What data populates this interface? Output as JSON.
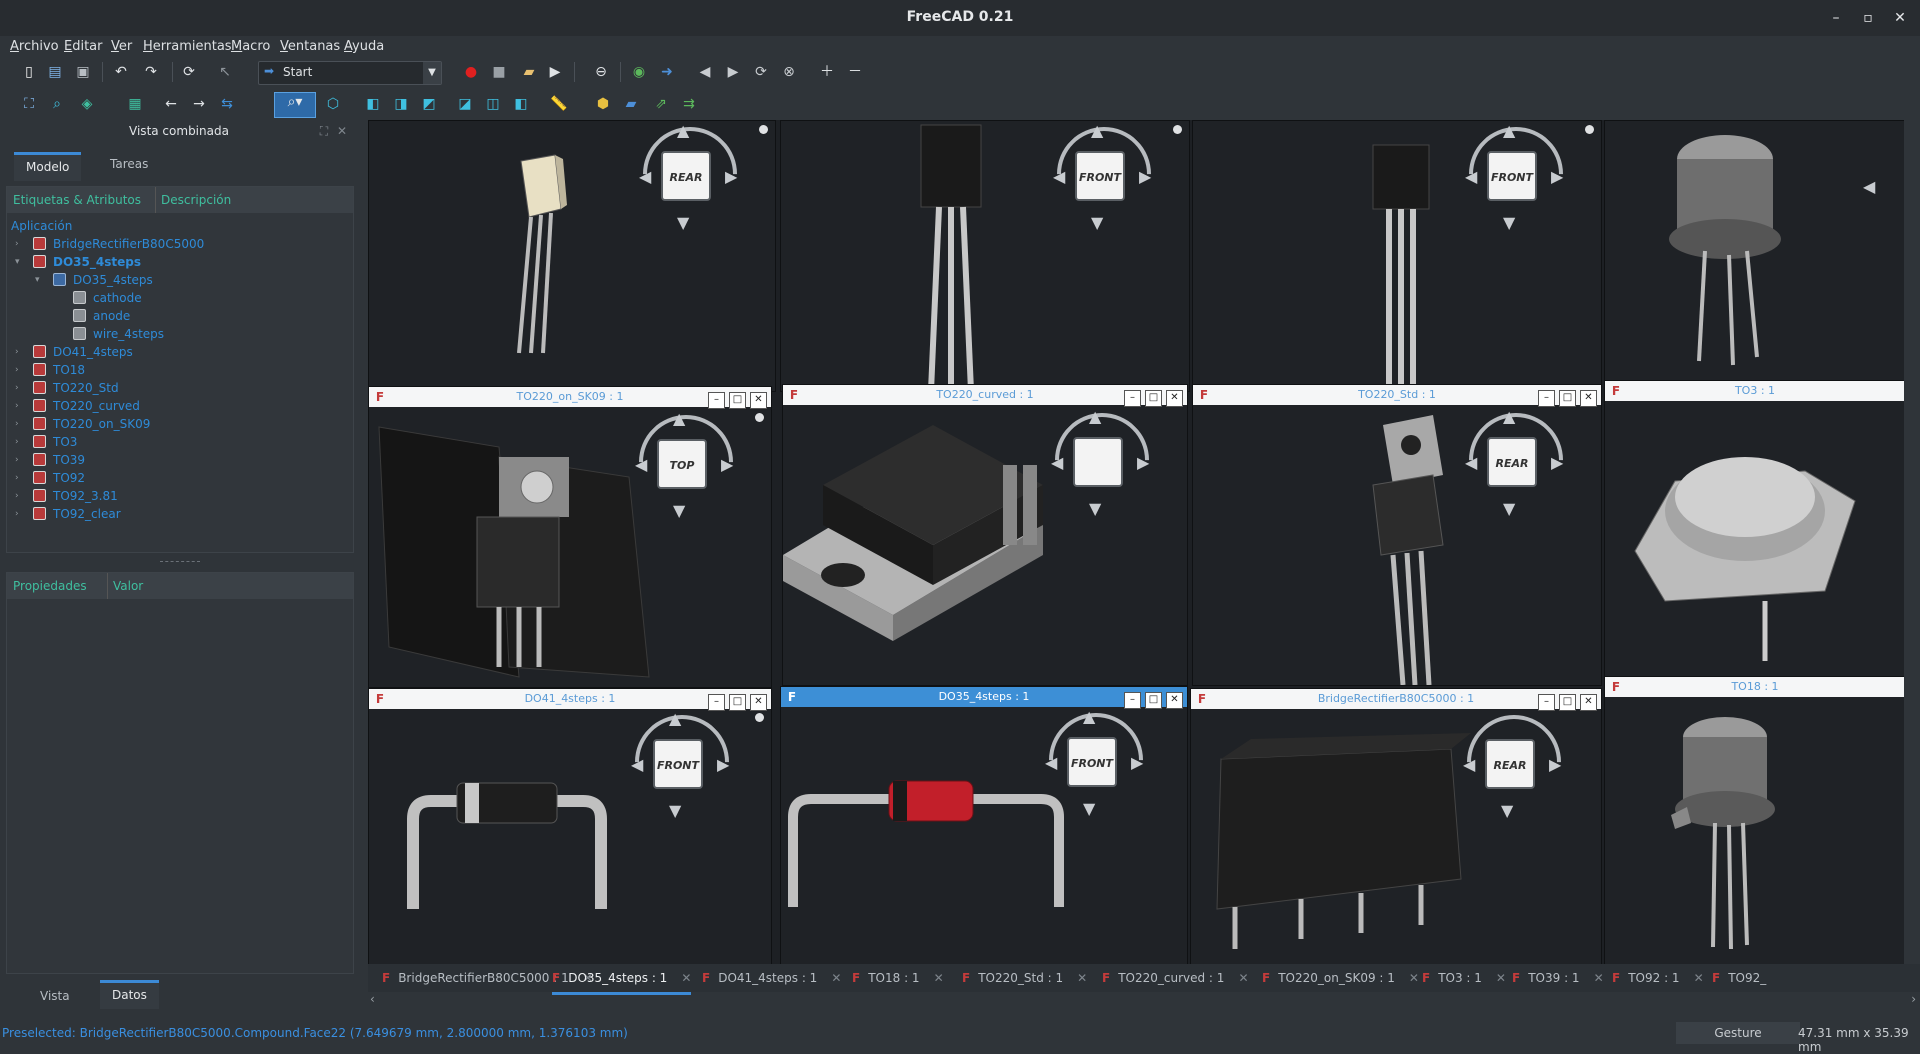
{
  "window": {
    "title": "FreeCAD 0.21"
  },
  "menu": [
    "Archivo",
    "Editar",
    "Ver",
    "Herramientas",
    "Macro",
    "Ventanas",
    "Ayuda"
  ],
  "workbench": {
    "selected": "Start"
  },
  "combo_view": {
    "title": "Vista combinada",
    "tabs": [
      "Modelo",
      "Tareas"
    ],
    "tree_headers": [
      "Etiquetas & Atributos",
      "Descripción"
    ],
    "app_label": "Aplicación",
    "tree": [
      {
        "label": "BridgeRectifierB80C5000",
        "level": 1,
        "icon": "document-icon"
      },
      {
        "label": "DO35_4steps",
        "level": 1,
        "icon": "document-icon",
        "selected": true
      },
      {
        "label": "DO35_4steps",
        "level": 2,
        "icon": "compound-icon"
      },
      {
        "label": "cathode",
        "level": 3,
        "icon": "part-icon"
      },
      {
        "label": "anode",
        "level": 3,
        "icon": "part-icon"
      },
      {
        "label": "wire_4steps",
        "level": 3,
        "icon": "part-icon"
      },
      {
        "label": "DO41_4steps",
        "level": 1,
        "icon": "document-icon"
      },
      {
        "label": "TO18",
        "level": 1,
        "icon": "document-icon"
      },
      {
        "label": "TO220_Std",
        "level": 1,
        "icon": "document-icon"
      },
      {
        "label": "TO220_curved",
        "level": 1,
        "icon": "document-icon"
      },
      {
        "label": "TO220_on_SK09",
        "level": 1,
        "icon": "document-icon"
      },
      {
        "label": "TO3",
        "level": 1,
        "icon": "document-icon"
      },
      {
        "label": "TO39",
        "level": 1,
        "icon": "document-icon"
      },
      {
        "label": "TO92",
        "level": 1,
        "icon": "document-icon"
      },
      {
        "label": "TO92_3.81",
        "level": 1,
        "icon": "document-icon"
      },
      {
        "label": "TO92_clear",
        "level": 1,
        "icon": "document-icon"
      }
    ],
    "prop_headers": [
      "Propiedades",
      "Valor"
    ],
    "bottom_tabs": [
      "Vista",
      "Datos"
    ]
  },
  "views": {
    "v_TO220_on_SK09": "TO220_on_SK09 : 1",
    "v_TO220_curved": "TO220_curved : 1",
    "v_TO220_Std": "TO220_Std : 1",
    "v_TO3": "TO3 : 1",
    "v_DO41": "DO41_4steps : 1",
    "v_DO35": "DO35_4steps : 1",
    "v_Bridge": "BridgeRectifierB80C5000 : 1",
    "v_TO18": "TO18 : 1"
  },
  "navcube_faces": {
    "rear": "REAR",
    "front": "FRONT",
    "top": "TOP"
  },
  "doc_tabs": [
    "BridgeRectifierB80C5000 : 1",
    "DO35_4steps : 1",
    "DO41_4steps : 1",
    "TO18 : 1",
    "TO220_Std : 1",
    "TO220_curved : 1",
    "TO220_on_SK09 : 1",
    "TO3 : 1",
    "TO39 : 1",
    "TO92 : 1",
    "TO92_"
  ],
  "status": {
    "message": "Preselected: BridgeRectifierB80C5000.Compound.Face22 (7.649679 mm, 2.800000 mm, 1.376103 mm)",
    "nav_style": "Gesture",
    "dimensions": "47.31 mm x 35.39 mm"
  }
}
